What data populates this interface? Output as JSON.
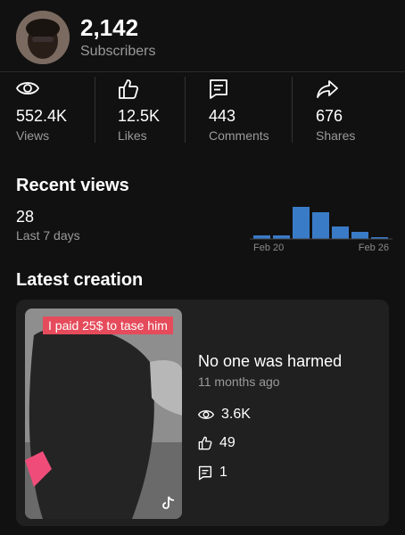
{
  "profile": {
    "subscriber_count": "2,142",
    "subscriber_label": "Subscribers"
  },
  "stats": [
    {
      "icon": "eye-icon",
      "value": "552.4K",
      "label": "Views"
    },
    {
      "icon": "thumbs-up-icon",
      "value": "12.5K",
      "label": "Likes"
    },
    {
      "icon": "comment-icon",
      "value": "443",
      "label": "Comments"
    },
    {
      "icon": "share-icon",
      "value": "676",
      "label": "Shares"
    }
  ],
  "recent_views": {
    "title": "Recent views",
    "count": "28",
    "period_label": "Last 7 days",
    "chart_data": {
      "type": "bar",
      "values": [
        2,
        2,
        18,
        15,
        7,
        4,
        1
      ],
      "tick_labels": [
        "Feb 20",
        "Feb 26"
      ],
      "colors": [
        "#3a7bc8",
        "#3a7bc8",
        "#3a7bc8",
        "#3a7bc8",
        "#3a7bc8",
        "#3a7bc8",
        "#3a7bc8"
      ]
    }
  },
  "latest_creation": {
    "title": "Latest creation",
    "thumbnail_caption": "I paid 25$ to tase him",
    "video_title": "No one was harmed",
    "posted": "11 months ago",
    "views": "3.6K",
    "likes": "49",
    "comments": "1"
  }
}
